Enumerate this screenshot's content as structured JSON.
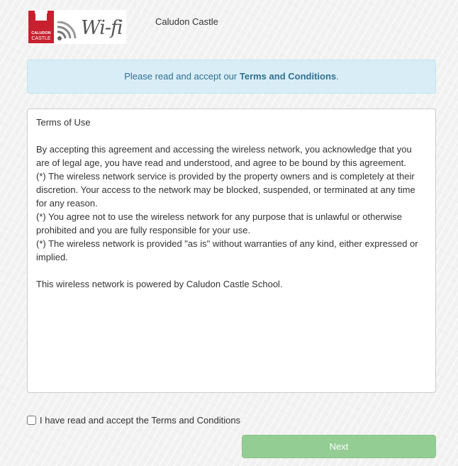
{
  "header": {
    "logo": {
      "mark_text_top": "CALUDON",
      "mark_text_bottom": "CASTLE",
      "wifi_text": "Wi-fi",
      "mark_color": "#c8202f"
    },
    "site_name": "Caludon Castle"
  },
  "notice": {
    "prefix": "Please read and accept our ",
    "link": "Terms and Conditions",
    "suffix": "."
  },
  "terms": {
    "title": "Terms of Use",
    "intro": "By accepting this agreement and accessing the wireless network, you acknowledge that you are of legal age, you have read and understood, and agree to be bound by this agreement.",
    "clauses": [
      "(*) The wireless network service is provided by the property owners and is completely at their discretion. Your access to the network may be blocked, suspended, or terminated at any time for any reason.",
      "(*) You agree not to use the wireless network for any purpose that is unlawful or otherwise prohibited and you are fully responsible for your use.",
      "(*) The wireless network is provided \"as is\" without warranties of any kind, either expressed or implied."
    ],
    "footer": "This wireless network is powered by Caludon Castle School."
  },
  "accept": {
    "label": "I have read and accept the Terms and Conditions",
    "checked": false
  },
  "next_button": {
    "label": "Next",
    "color": "#8fcc8f"
  }
}
